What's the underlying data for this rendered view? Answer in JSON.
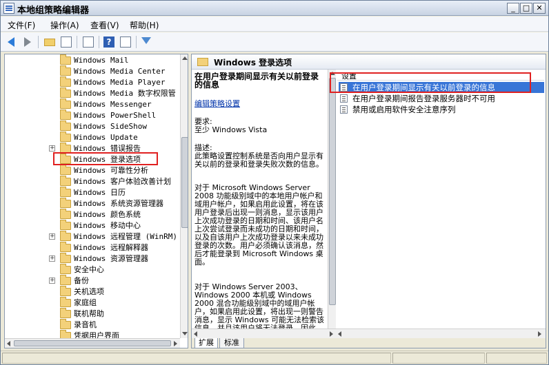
{
  "window": {
    "title": "本地组策略编辑器"
  },
  "menu": {
    "items": [
      "文件(F)",
      "操作(A)",
      "查看(V)",
      "帮助(H)"
    ]
  },
  "tree": {
    "items": [
      {
        "label": "Windows Mail",
        "expander": ""
      },
      {
        "label": "Windows Media Center",
        "expander": ""
      },
      {
        "label": "Windows Media Player",
        "expander": ""
      },
      {
        "label": "Windows Media 数字权限管",
        "expander": ""
      },
      {
        "label": "Windows Messenger",
        "expander": ""
      },
      {
        "label": "Windows PowerShell",
        "expander": ""
      },
      {
        "label": "Windows SideShow",
        "expander": ""
      },
      {
        "label": "Windows Update",
        "expander": ""
      },
      {
        "label": "Windows 错误报告",
        "expander": "+"
      },
      {
        "label": "Windows 登录选项",
        "expander": ""
      },
      {
        "label": "Windows 可靠性分析",
        "expander": ""
      },
      {
        "label": "Windows 客户体验改善计划",
        "expander": ""
      },
      {
        "label": "Windows 日历",
        "expander": ""
      },
      {
        "label": "Windows 系统资源管理器",
        "expander": ""
      },
      {
        "label": "Windows 颜色系统",
        "expander": ""
      },
      {
        "label": "Windows 移动中心",
        "expander": ""
      },
      {
        "label": "Windows 远程管理 (WinRM)",
        "expander": "+"
      },
      {
        "label": "Windows 远程解释器",
        "expander": ""
      },
      {
        "label": "Windows 资源管理器",
        "expander": "+"
      },
      {
        "label": "安全中心",
        "expander": ""
      },
      {
        "label": "备份",
        "expander": "+"
      },
      {
        "label": "关机选项",
        "expander": ""
      },
      {
        "label": "家庭组",
        "expander": ""
      },
      {
        "label": "联机帮助",
        "expander": ""
      },
      {
        "label": "录音机",
        "expander": ""
      },
      {
        "label": "凭据用户界面",
        "expander": ""
      }
    ]
  },
  "right": {
    "header_title": "Windows 登录选项",
    "desc": {
      "title": "在用户登录期间显示有关以前登录的信息",
      "edit_link": "编辑策略设置",
      "req_label": "要求:",
      "req_value": "至少 Windows Vista",
      "desc_label": "描述:",
      "desc_text": "此策略设置控制系统是否向用户显示有关以前的登录和登录失败次数的信息。",
      "para1": "对于 Microsoft Windows Server 2008 功能级别域中的本地用户帐户和域用户帐户，如果启用此设置，将在该用户登录后出现一则消息，显示该用户上次成功登录的日期和时间、该用户名上次尝试登录而未成功的日期和时间，以及自该用户上次成功登录以来未成功登录的次数。用户必须确认该消息，然后才能登录到 Microsoft Windows 桌面。",
      "para2": "对于 Windows Server 2003、Windows 2000 本机或 Windows 2000 混合功能级别域中的域用户帐户，如果启用此设置，将出现一则警告消息，显示 Windows 可能无法检索该信息，并且该用户将无法登录。因此，如果该域不属于"
    },
    "list": {
      "column_header": "设置",
      "rows": [
        "在用户登录期间显示有关以前登录的信息",
        "在用户登录期间报告登录服务器时不可用",
        "禁用或启用软件安全注意序列"
      ]
    },
    "tabs": [
      "扩展",
      "标准"
    ]
  }
}
